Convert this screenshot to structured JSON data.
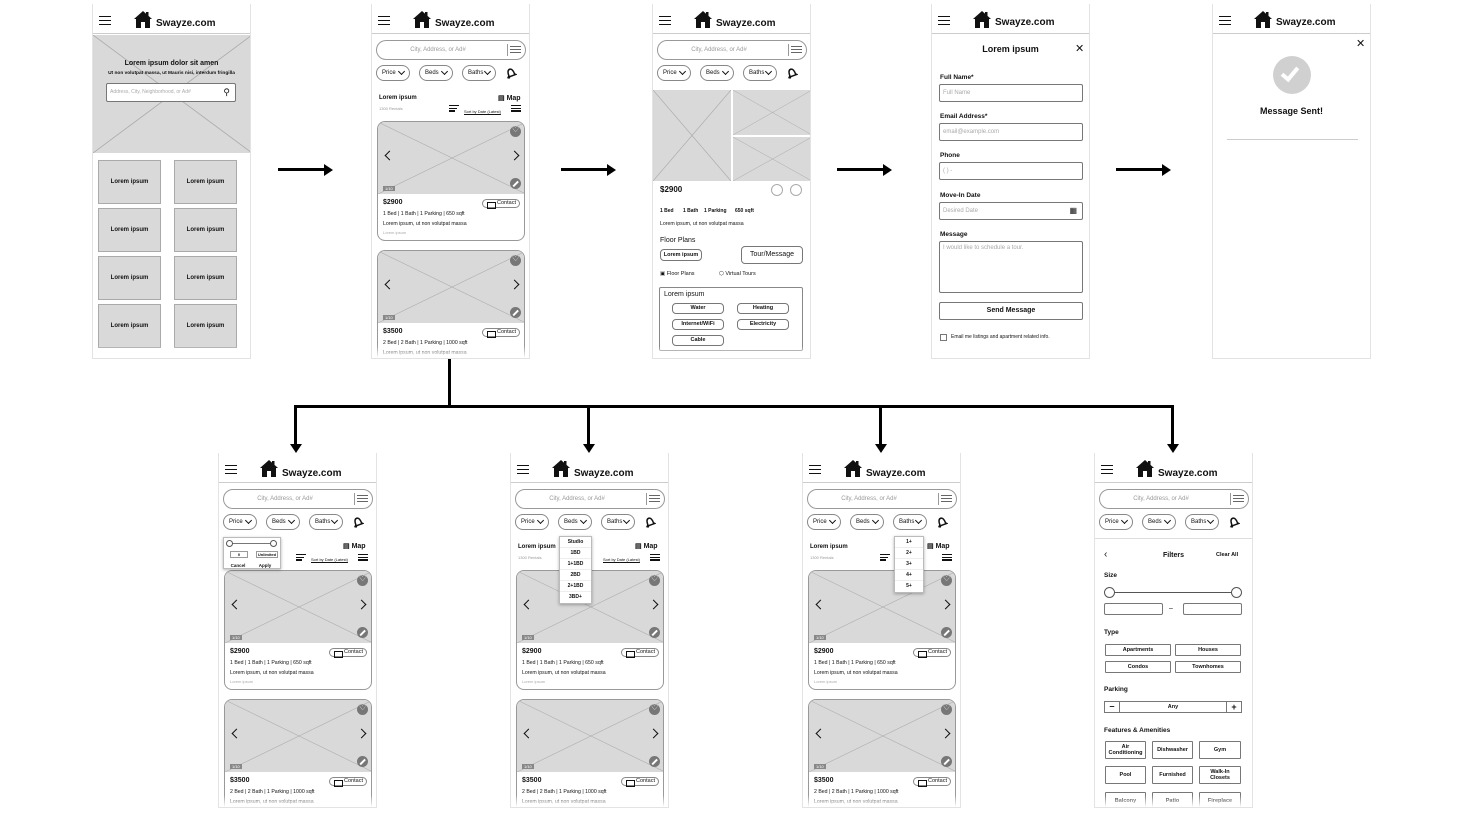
{
  "brand": "Swayze.com",
  "search_placeholder": "City, Address, or Ad#",
  "filters": {
    "price": "Price",
    "beds": "Beds",
    "baths": "Baths"
  },
  "home": {
    "hero_title": "Lorem ipsum dolor sit amen",
    "hero_subtitle": "Ut non volutpat massa, ut Mauris nisi, interdum fringilla",
    "search_placeholder": "Address, City, Neighborhood, or Ad#",
    "tiles": [
      "Lorem ipsum",
      "Lorem ipsum",
      "Lorem ipsum",
      "Lorem ipsum",
      "Lorem ipsum",
      "Lorem ipsum",
      "Lorem ipsum",
      "Lorem ipsum"
    ]
  },
  "results": {
    "heading": "Lorem ipsum",
    "count_label": "1300 Rentals",
    "map_label": "Map",
    "sort_label": "Sort by Date (Latest)"
  },
  "listings": [
    {
      "price": "$2900",
      "specs": "1 Bed  |  1 Bath  |  1 Parking  |  650 sqft",
      "desc": "Lorem ipsum, ut non volutpat massa",
      "sub": "Lorem ipsum",
      "count": "1/10",
      "contact": "Contact"
    },
    {
      "price": "$3500",
      "specs": "2 Bed  |  2 Bath  |  1 Parking  |  1000 sqft",
      "desc": "Lorem ipsum, ut non volutpat massa",
      "sub": "Lorem ipsum",
      "count": "1/10",
      "contact": "Contact"
    }
  ],
  "detail": {
    "price": "$2900",
    "amenity_icons": [
      "1 Bed",
      "1 Bath",
      "1 Parking",
      "650 sqft"
    ],
    "desc": "Lorem ipsum, ut non volutpat massa",
    "floor_plans": "Floor Plans",
    "plan_tag": "Lorem ipsum",
    "tour_button": "Tour/Message",
    "floor_plans_link": "Floor Plans",
    "virtual_tours_link": "Virtual Tours",
    "utilities_title": "Lorem ipsum",
    "utilities": [
      "Water",
      "Heating",
      "Internet/WiFi",
      "Electricity",
      "Cable"
    ]
  },
  "form": {
    "title": "Lorem ipsum",
    "name_label": "Full Name*",
    "name_ph": "Full Name",
    "email_label": "Email Address*",
    "email_ph": "email@example.com",
    "phone_label": "Phone",
    "phone_ph": "(     )  -",
    "date_label": "Move-In Date",
    "date_ph": "Desired Date",
    "message_label": "Message",
    "message_ph": "I would like to schedule a tour.",
    "send": "Send Message",
    "optin": "Email me listings and apartment related info."
  },
  "sent": {
    "title": "Message Sent!"
  },
  "price_dropdown": {
    "min": "0",
    "max": "Unlimited",
    "cancel": "Cancel",
    "apply": "Apply"
  },
  "beds_options": [
    "Studio",
    "1BD",
    "1+1BD",
    "2BD",
    "2+1BD",
    "3BD+"
  ],
  "baths_options": [
    "1+",
    "2+",
    "3+",
    "4+",
    "5+"
  ],
  "filters_panel": {
    "title": "Filters",
    "clear": "Clear All",
    "size": "Size",
    "range_dash": "–",
    "type": "Type",
    "types": [
      "Apartments",
      "Houses",
      "Condos",
      "Townhomes"
    ],
    "parking": "Parking",
    "parking_value": "Any",
    "features": "Features & Amenities",
    "feature_items": [
      "Air Conditioning",
      "Dishwasher",
      "Gym",
      "Pool",
      "Furnished",
      "Walk-In Closets",
      "Balcony",
      "Patio",
      "Fireplace"
    ]
  }
}
